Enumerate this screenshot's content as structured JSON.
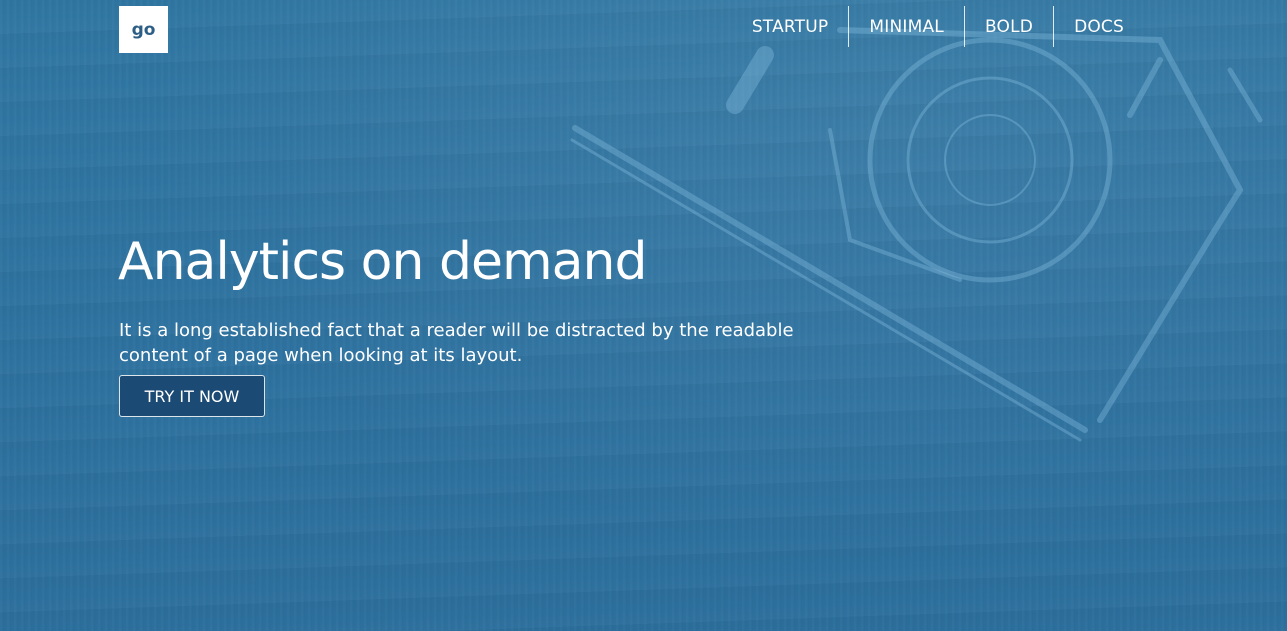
{
  "brand": {
    "logo_text": "go"
  },
  "nav": {
    "items": [
      {
        "label": "STARTUP"
      },
      {
        "label": "MINIMAL"
      },
      {
        "label": "BOLD"
      },
      {
        "label": "DOCS"
      }
    ]
  },
  "hero": {
    "headline": "Analytics on demand",
    "subtext": "It is a long established fact that a reader will be distracted by the readable content of a page when looking at its layout.",
    "cta_label": "TRY IT NOW",
    "background_icon": "camera-icon"
  },
  "colors": {
    "hero_overlay": "#2f74a0",
    "cta_background": "#1b4a75",
    "logo_text": "#2d5f86",
    "text": "#ffffff"
  }
}
